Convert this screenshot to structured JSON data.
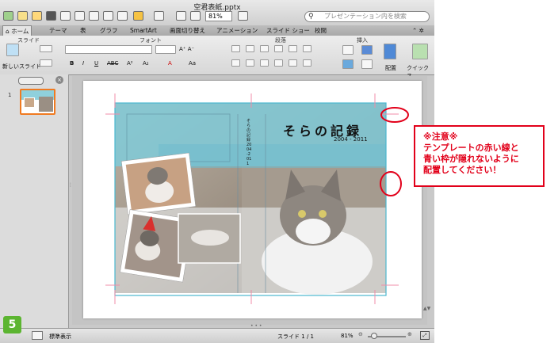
{
  "window": {
    "title": "空君表紙.pptx"
  },
  "toolbar": {
    "zoom": "81%",
    "search_placeholder": "プレゼンテーション内を検索"
  },
  "ribbon_tabs": [
    "ホーム",
    "テーマ",
    "表",
    "グラフ",
    "SmartArt",
    "画面切り替え",
    "アニメーション",
    "スライド ショー",
    "校閲"
  ],
  "ribbon_groups": [
    "スライド",
    "フォント",
    "段落",
    "挿入"
  ],
  "ribbon_buttons": {
    "new_slide": "新しいスライド",
    "arrange": "配置",
    "quick_styles": "クイック ス"
  },
  "slide_panel": {
    "number": "1"
  },
  "slide": {
    "title": "そらの記録",
    "years": "2004 - 2011",
    "spine_text": "そらの記録 2004-2011"
  },
  "status": {
    "view": "標準表示",
    "slide_label": "スライド",
    "slide_pos": "1",
    "slide_sep": "/",
    "slide_total": "1",
    "zoom": "81%"
  },
  "callout": {
    "lines": [
      "※注意※",
      "テンプレートの赤い線と",
      "青い枠が隠れないように",
      "配置してください！"
    ]
  },
  "step_badge": "5",
  "colors": {
    "accent_red": "#e2001a",
    "cover_blue": "#7fcad8",
    "badge_green": "#5cb531",
    "guide_pink": "#f08ca8"
  }
}
